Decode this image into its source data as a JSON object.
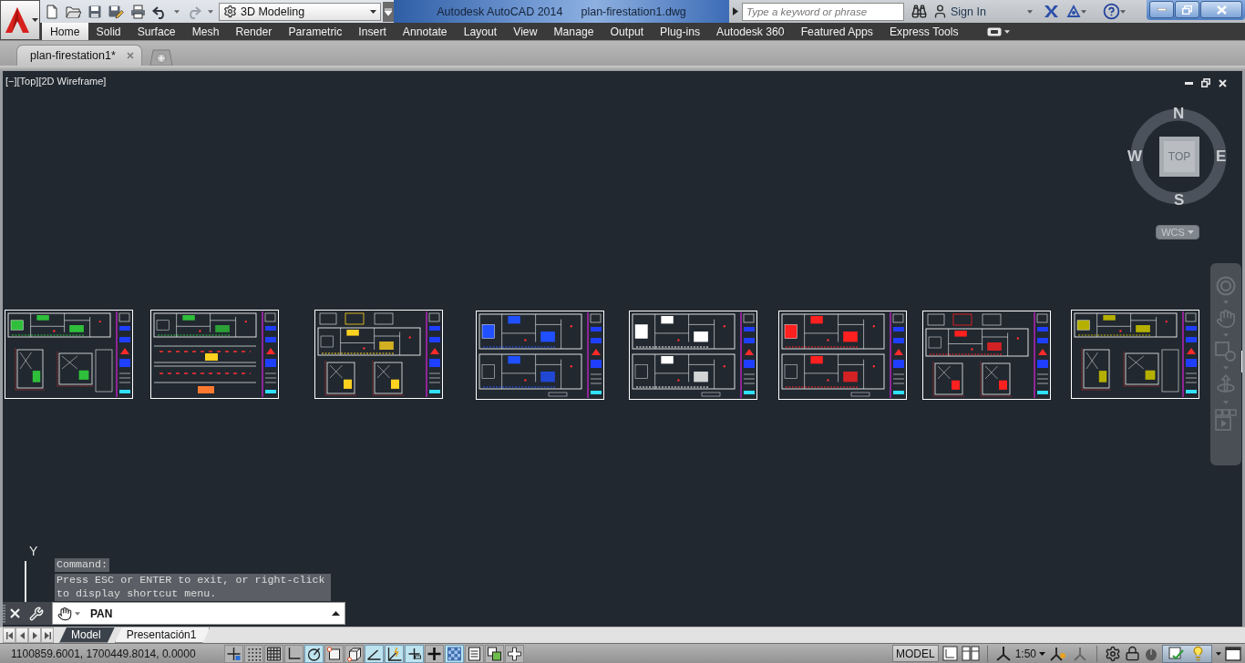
{
  "title_bar": {
    "workspace": "3D Modeling",
    "title": "Autodesk AutoCAD 2014",
    "document": "plan-firestation1.dwg",
    "search": {
      "placeholder": "Type a keyword or phrase"
    },
    "sign_in": "Sign In"
  },
  "ribbon_tabs": [
    {
      "label": "Home",
      "selected": true
    },
    {
      "label": "Solid",
      "selected": false
    },
    {
      "label": "Surface",
      "selected": false
    },
    {
      "label": "Mesh",
      "selected": false
    },
    {
      "label": "Render",
      "selected": false
    },
    {
      "label": "Parametric",
      "selected": false
    },
    {
      "label": "Insert",
      "selected": false
    },
    {
      "label": "Annotate",
      "selected": false
    },
    {
      "label": "Layout",
      "selected": false
    },
    {
      "label": "View",
      "selected": false
    },
    {
      "label": "Manage",
      "selected": false
    },
    {
      "label": "Output",
      "selected": false
    },
    {
      "label": "Plug-ins",
      "selected": false
    },
    {
      "label": "Autodesk 360",
      "selected": false
    },
    {
      "label": "Featured Apps",
      "selected": false
    },
    {
      "label": "Express Tools",
      "selected": false
    }
  ],
  "file_tabs": [
    {
      "label": "plan-firestation1*",
      "selected": true
    }
  ],
  "viewport": {
    "controls": [
      "[−]",
      "[Top]",
      "[2D Wireframe]"
    ],
    "viewcube": {
      "face": "TOP",
      "north": "N",
      "east": "E",
      "south": "S",
      "west": "W",
      "coordinate_system": "WCS"
    },
    "ucs_axis_label": "Y"
  },
  "command_history": [
    "Command:",
    "Press ESC or ENTER to exit, or right-click to display shortcut menu."
  ],
  "command_line": {
    "value": "PAN"
  },
  "layout_tabs": [
    {
      "label": "Model",
      "selected": true
    },
    {
      "label": "Presentación1",
      "selected": false
    }
  ],
  "status_bar": {
    "coordinates": "1100859.6001, 1700449.8014, 0.0000",
    "toggles": [
      {
        "on": false
      },
      {
        "on": false
      },
      {
        "on": false
      },
      {
        "on": false
      },
      {
        "on": true
      },
      {
        "on": false
      },
      {
        "on": false
      },
      {
        "on": true
      },
      {
        "on": true
      },
      {
        "on": true
      },
      {
        "on": false
      },
      {
        "on": true
      },
      {
        "on": false
      },
      {
        "on": false
      },
      {
        "on": false
      }
    ],
    "space": "MODEL",
    "annotation_scale": "1:50"
  }
}
